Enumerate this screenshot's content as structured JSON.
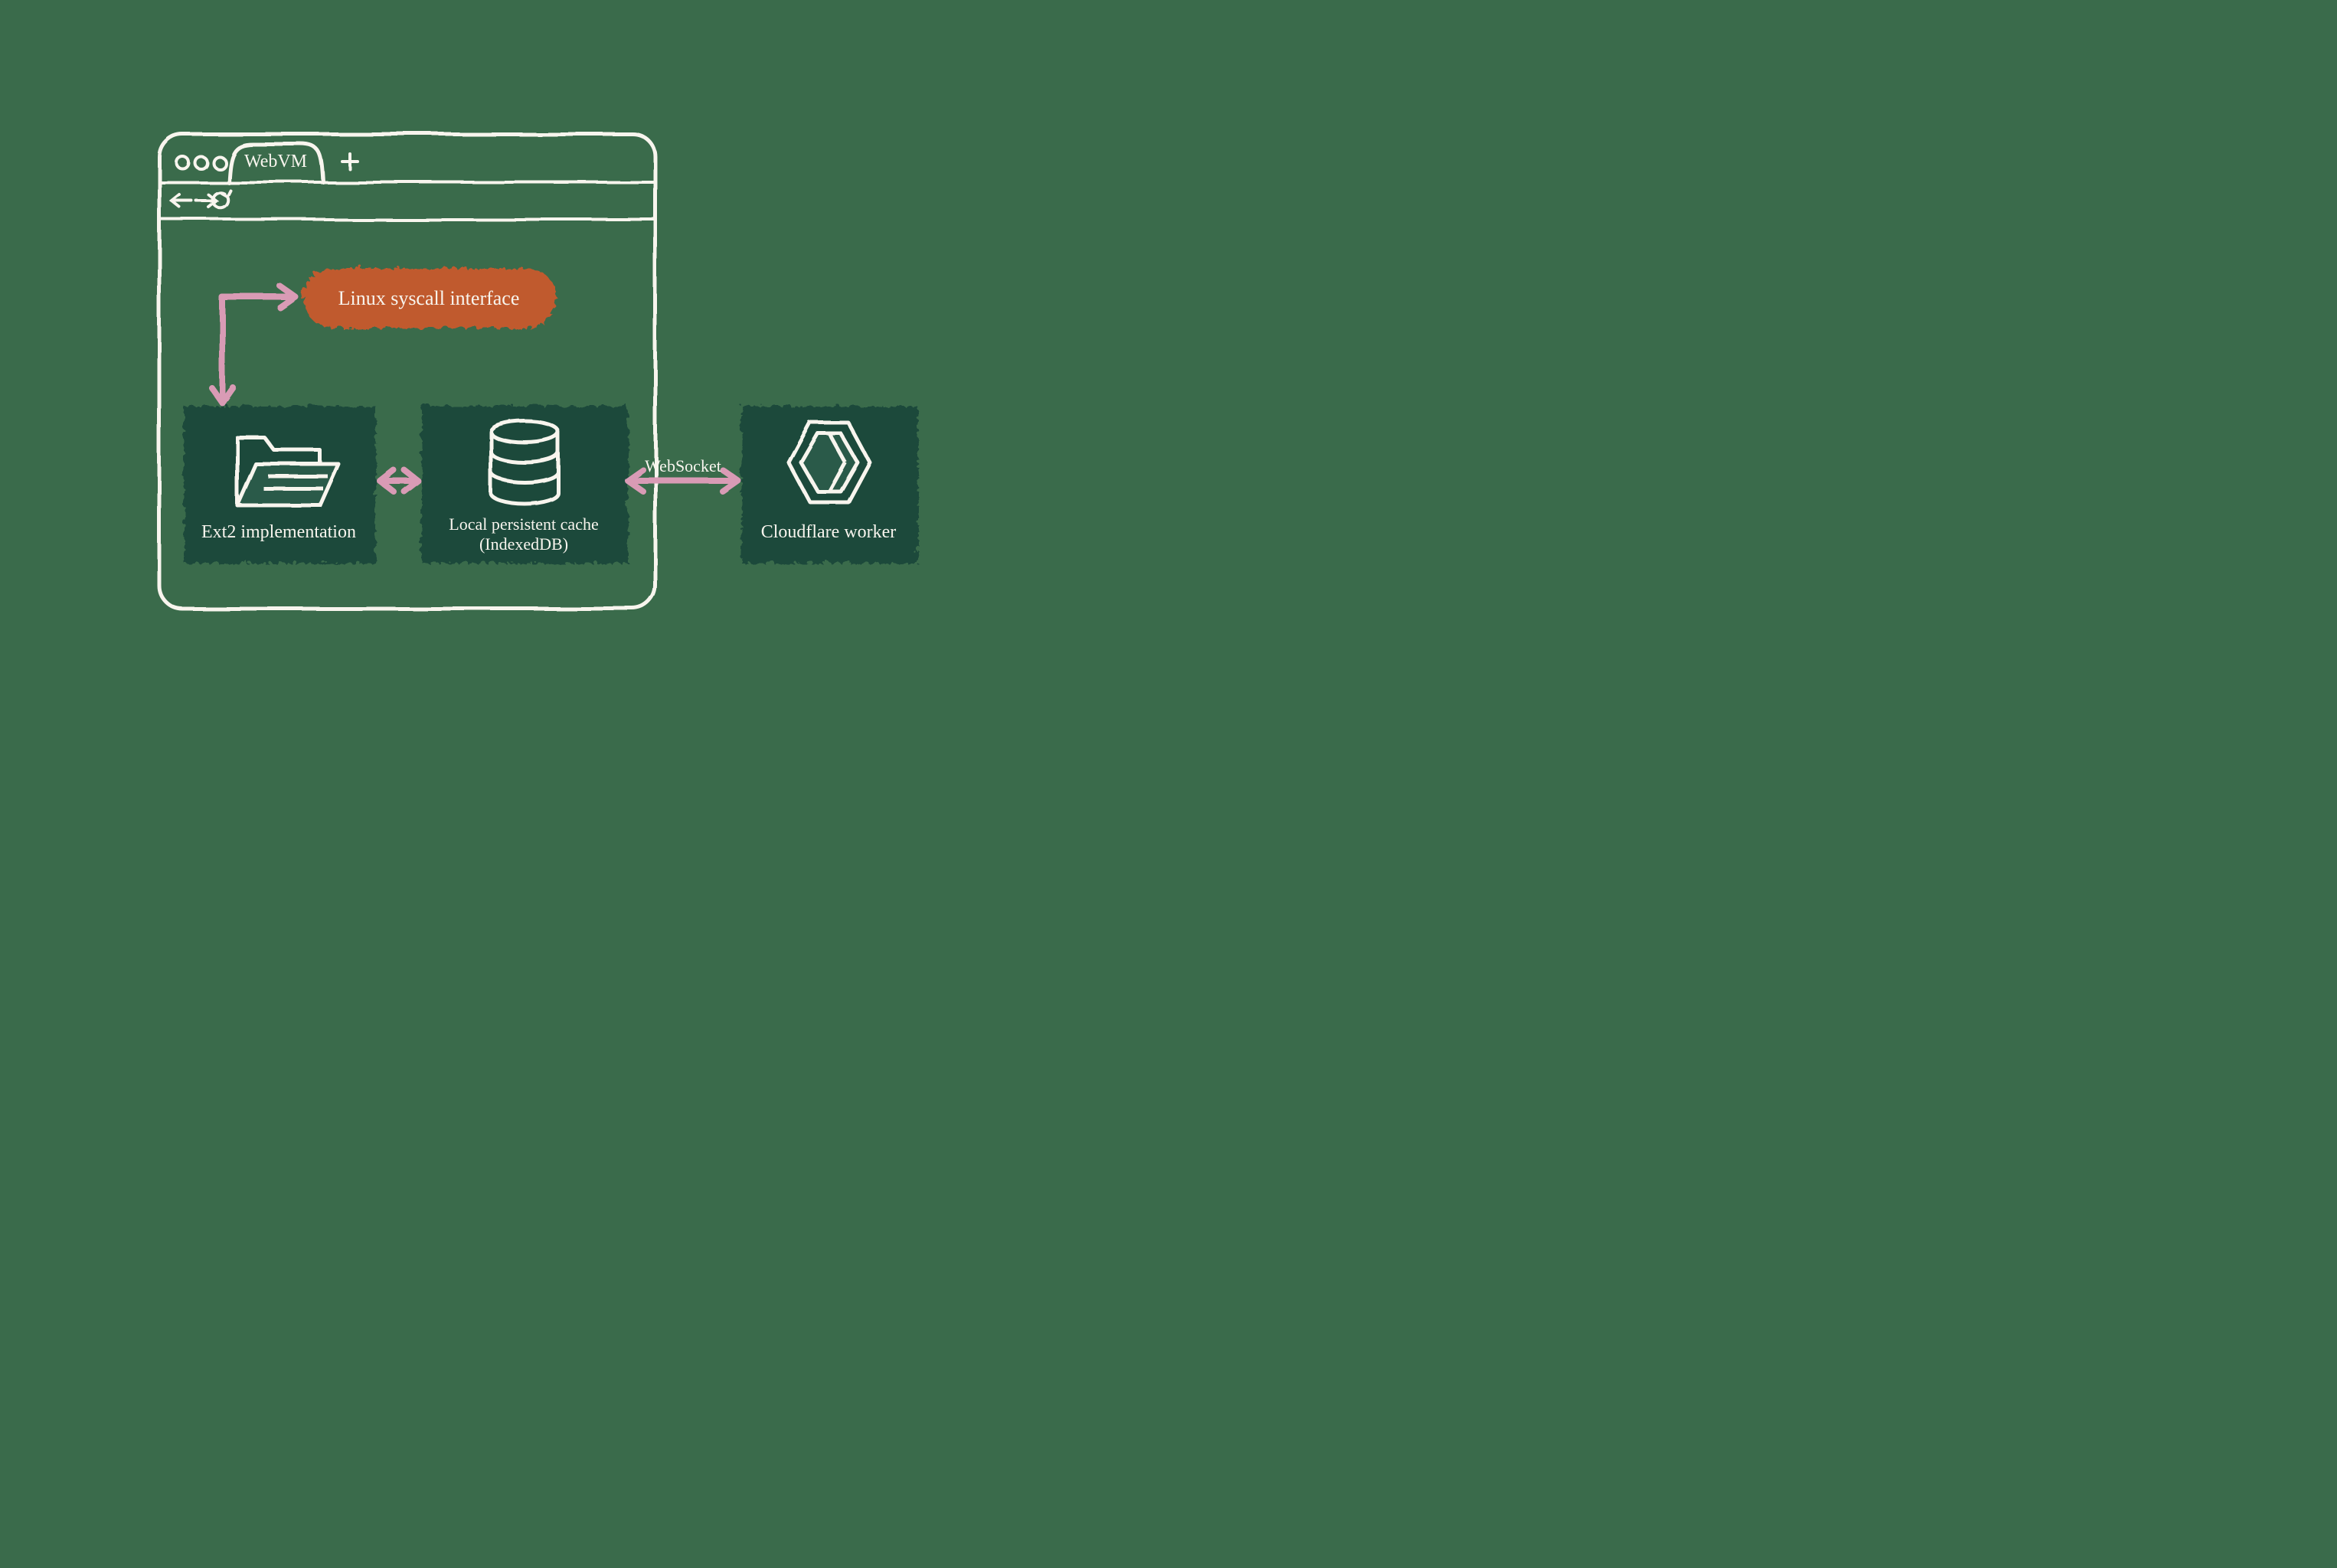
{
  "diagram": {
    "browser_tab_title": "WebVM",
    "nodes": {
      "syscall": {
        "label": "Linux syscall interface"
      },
      "ext2": {
        "label": "Ext2 implementation"
      },
      "cache": {
        "label_line1": "Local persistent cache",
        "label_line2": "(IndexedDB)"
      },
      "worker": {
        "label": "Cloudflare worker"
      }
    },
    "edges": {
      "cache_to_worker": {
        "label": "WebSocket"
      }
    },
    "colors": {
      "background": "#3a6b4b",
      "box_dark": "#1a4a3a",
      "orange": "#c05a2e",
      "ink": "#f8f5ee",
      "arrow": "#d99bb5"
    }
  }
}
